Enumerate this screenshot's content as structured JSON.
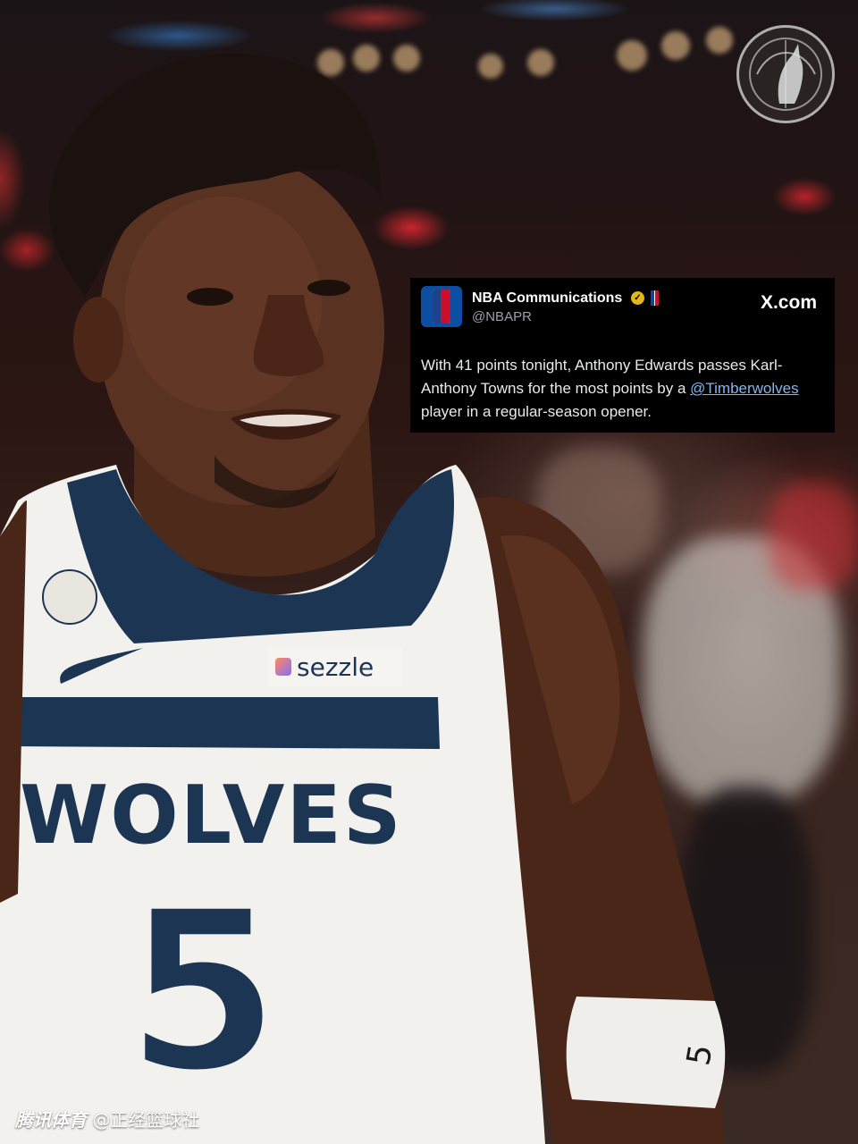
{
  "tweet": {
    "author_name": "NBA Communications",
    "author_handle": "@NBAPR",
    "site": "X.com",
    "text_before_mention": "With 41 points tonight, Anthony Edwards passes Karl-Anthony Towns for the most points by a ",
    "mention": "@Timberwolves",
    "text_after_mention": " player in a regular-season opener."
  },
  "jersey": {
    "team_text": "WOLVES",
    "number": "5",
    "sponsor": "sezzle",
    "wristband_number": "5"
  },
  "watermark": {
    "brand": "腾讯体育",
    "account": "@正经篮球社"
  },
  "colors": {
    "navy": "#1c3552",
    "jersey_white": "#f2f1ee",
    "skin": "#5a3222",
    "tweet_bg": "#000000",
    "mention_blue": "#7fb8f3",
    "verified_gold": "#e2b719"
  }
}
